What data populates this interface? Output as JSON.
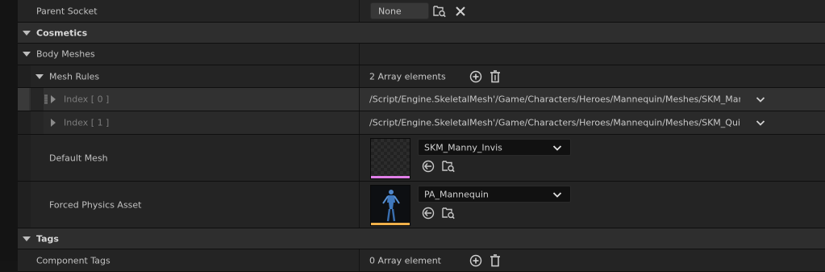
{
  "colors": {
    "skeletal_mesh_accent": "#e07ee8",
    "physics_asset_accent": "#f0b04a",
    "panel_bg": "#242424",
    "category_bg": "#2e2e2e"
  },
  "parent_socket": {
    "label": "Parent Socket",
    "value": "None",
    "icons": [
      "browse-socket-icon",
      "clear-x-icon"
    ]
  },
  "categories": {
    "cosmetics": "Cosmetics",
    "tags": "Tags"
  },
  "body_meshes": {
    "label": "Body Meshes",
    "mesh_rules": {
      "label": "Mesh Rules",
      "count_text": "2 Array elements",
      "items": [
        {
          "label": "Index [ 0 ]",
          "value": "/Script/Engine.SkeletalMesh'/Game/Characters/Heroes/Mannequin/Meshes/SKM_Manny_Invis'"
        },
        {
          "label": "Index [ 1 ]",
          "value": "/Script/Engine.SkeletalMesh'/Game/Characters/Heroes/Mannequin/Meshes/SKM_Quinn_Invis'"
        }
      ]
    },
    "default_mesh": {
      "label": "Default Mesh",
      "value": "SKM_Manny_Invis"
    },
    "forced_physics_asset": {
      "label": "Forced Physics Asset",
      "value": "PA_Mannequin"
    }
  },
  "tags": {
    "component_tags": {
      "label": "Component Tags",
      "count_text": "0 Array element"
    }
  }
}
